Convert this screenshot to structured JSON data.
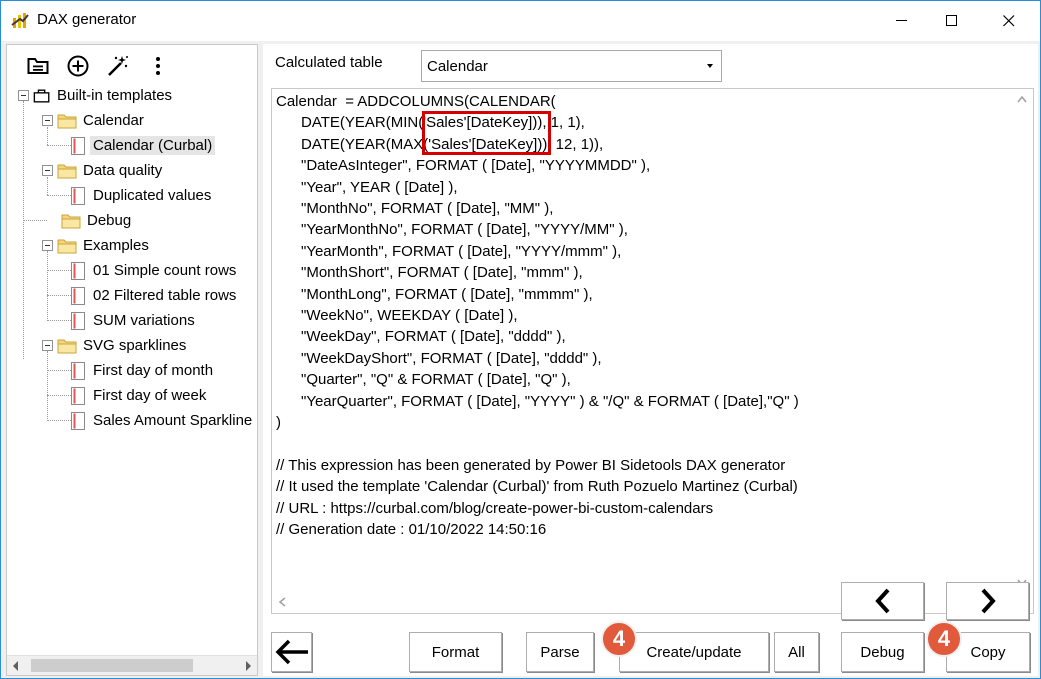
{
  "window": {
    "title": "DAX generator"
  },
  "tree": {
    "items": [
      {
        "label": "Built-in templates"
      },
      {
        "label": "Calendar"
      },
      {
        "label": "Calendar (Curbal)"
      },
      {
        "label": "Data quality"
      },
      {
        "label": "Duplicated values"
      },
      {
        "label": "Debug"
      },
      {
        "label": "Examples"
      },
      {
        "label": "01 Simple count rows"
      },
      {
        "label": "02 Filtered table rows"
      },
      {
        "label": "SUM variations"
      },
      {
        "label": "SVG sparklines"
      },
      {
        "label": "First day of month"
      },
      {
        "label": "First day of week"
      },
      {
        "label": "Sales Amount Sparkline"
      }
    ]
  },
  "header": {
    "calc_label": "Calculated table",
    "table_select_value": "Calendar"
  },
  "code": {
    "text": "Calendar  = ADDCOLUMNS(CALENDAR(\n      DATE(YEAR(MIN('Sales'[DateKey])), 1, 1),\n      DATE(YEAR(MAX('Sales'[DateKey])), 12, 1)),\n      \"DateAsInteger\", FORMAT ( [Date], \"YYYYMMDD\" ),\n      \"Year\", YEAR ( [Date] ),\n      \"MonthNo\", FORMAT ( [Date], \"MM\" ),\n      \"YearMonthNo\", FORMAT ( [Date], \"YYYY/MM\" ),\n      \"YearMonth\", FORMAT ( [Date], \"YYYY/mmm\" ),\n      \"MonthShort\", FORMAT ( [Date], \"mmm\" ),\n      \"MonthLong\", FORMAT ( [Date], \"mmmm\" ),\n      \"WeekNo\", WEEKDAY ( [Date] ),\n      \"WeekDay\", FORMAT ( [Date], \"dddd\" ),\n      \"WeekDayShort\", FORMAT ( [Date], \"dddd\" ),\n      \"Quarter\", \"Q\" & FORMAT ( [Date], \"Q\" ),\n      \"YearQuarter\", FORMAT ( [Date], \"YYYY\" ) & \"/Q\" & FORMAT ( [Date],\"Q\" )\n)\n\n// This expression has been generated by Power BI Sidetools DAX generator\n// It used the template 'Calendar (Curbal)' from Ruth Pozuelo Martinez (Curbal)\n// URL : https://curbal.com/blog/create-power-bi-custom-calendars\n// Generation date : 01/10/2022 14:50:16"
  },
  "buttons": {
    "format": "Format",
    "parse": "Parse",
    "create_update": "Create/update",
    "all": "All",
    "debug": "Debug",
    "copy": "Copy"
  },
  "badges": {
    "create_step": "4",
    "copy_step": "4"
  },
  "colors": {
    "window_border": "#2b8cd8",
    "highlight": "#d40000",
    "badge": "#e15a3c"
  }
}
